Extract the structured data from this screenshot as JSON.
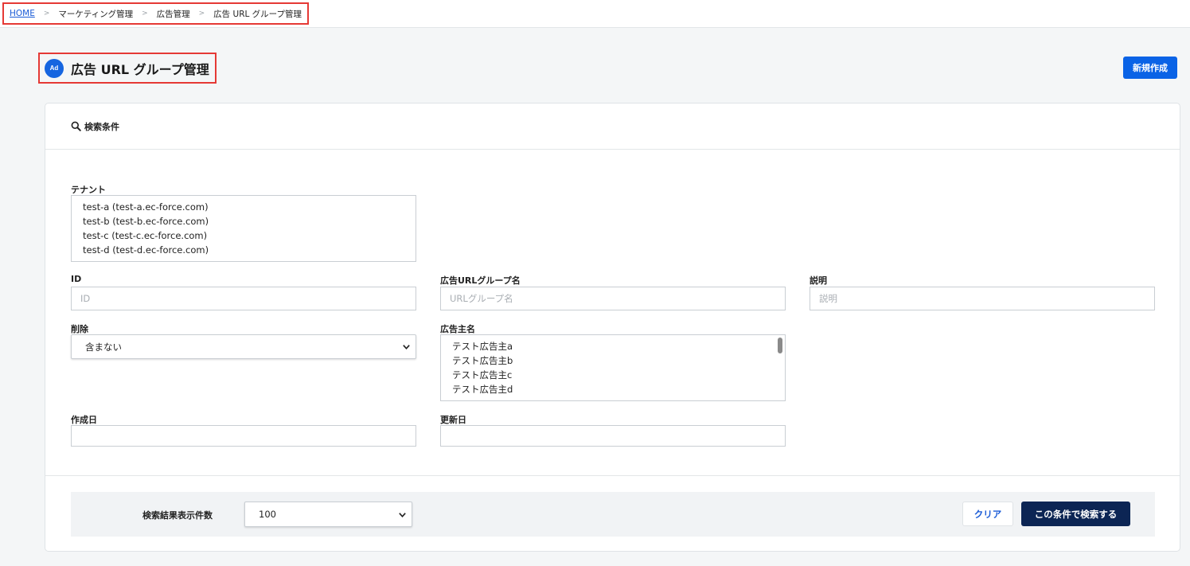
{
  "breadcrumb": {
    "home": "HOME",
    "separator": ">",
    "items": [
      "マーケティング管理",
      "広告管理",
      "広告 URL グループ管理"
    ]
  },
  "page": {
    "icon_text": "Ad",
    "title": "広告 URL グループ管理",
    "new_button": "新規作成"
  },
  "search": {
    "header": "検索条件",
    "tenant": {
      "label": "テナント",
      "options": [
        "test-a (test-a.ec-force.com)",
        "test-b (test-b.ec-force.com)",
        "test-c (test-c.ec-force.com)",
        "test-d (test-d.ec-force.com)"
      ]
    },
    "id": {
      "label": "ID",
      "placeholder": "ID"
    },
    "url_group_name": {
      "label": "広告URLグループ名",
      "placeholder": "URLグループ名"
    },
    "description": {
      "label": "説明",
      "placeholder": "説明"
    },
    "deleted": {
      "label": "削除",
      "value": "含まない"
    },
    "advertiser": {
      "label": "広告主名",
      "options": [
        "テスト広告主a",
        "テスト広告主b",
        "テスト広告主c",
        "テスト広告主d"
      ]
    },
    "created_at": {
      "label": "作成日",
      "value": ""
    },
    "updated_at": {
      "label": "更新日",
      "value": ""
    }
  },
  "footer": {
    "count_label": "検索結果表示件数",
    "count_value": "100",
    "clear_button": "クリア",
    "search_button": "この条件で検索する"
  },
  "colors": {
    "primary": "#0a63e6",
    "dark_button": "#0c2554",
    "highlight_border": "#e53935"
  }
}
